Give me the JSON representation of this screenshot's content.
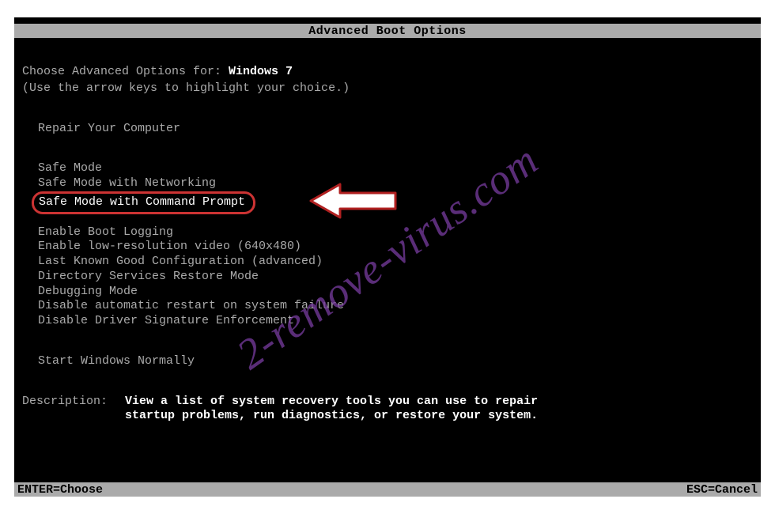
{
  "header": {
    "title": "Advanced Boot Options"
  },
  "intro": {
    "prefix": "Choose Advanced Options for: ",
    "os": "Windows 7",
    "hint": "(Use the arrow keys to highlight your choice.)"
  },
  "groups": {
    "repair": [
      "Repair Your Computer"
    ],
    "safe": [
      "Safe Mode",
      "Safe Mode with Networking",
      "Safe Mode with Command Prompt"
    ],
    "advanced": [
      "Enable Boot Logging",
      "Enable low-resolution video (640x480)",
      "Last Known Good Configuration (advanced)",
      "Directory Services Restore Mode",
      "Debugging Mode",
      "Disable automatic restart on system failure",
      "Disable Driver Signature Enforcement"
    ],
    "normal": [
      "Start Windows Normally"
    ]
  },
  "description": {
    "label": "Description:",
    "text": "View a list of system recovery tools you can use to repair startup problems, run diagnostics, or restore your system."
  },
  "footer": {
    "enter": "ENTER=Choose",
    "esc": "ESC=Cancel"
  },
  "watermark": "2-remove-virus.com"
}
